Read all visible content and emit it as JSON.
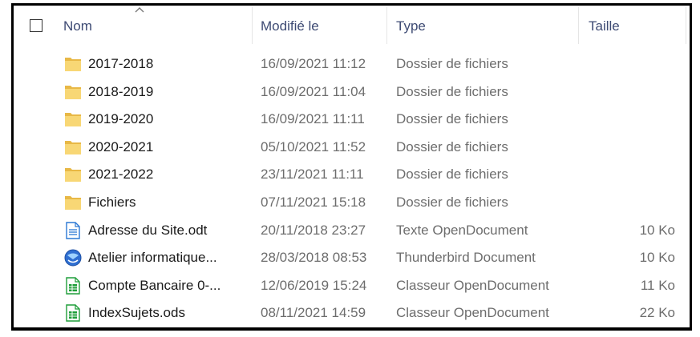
{
  "header": {
    "name": "Nom",
    "modified": "Modifié le",
    "type": "Type",
    "size": "Taille"
  },
  "colors": {
    "folder": "#f8d775",
    "folder_tab": "#e8b846",
    "header_text": "#3d4a73",
    "secondary_text": "#6d6d6d",
    "doc_blue": "#2b78d4",
    "sheet_green": "#1f9e3a"
  },
  "files": [
    {
      "name": "2017-2018",
      "modified": "16/09/2021 11:12",
      "type": "Dossier de fichiers",
      "size": "",
      "icon": "folder-icon"
    },
    {
      "name": "2018-2019",
      "modified": "16/09/2021 11:04",
      "type": "Dossier de fichiers",
      "size": "",
      "icon": "folder-icon"
    },
    {
      "name": "2019-2020",
      "modified": "16/09/2021 11:11",
      "type": "Dossier de fichiers",
      "size": "",
      "icon": "folder-icon"
    },
    {
      "name": "2020-2021",
      "modified": "05/10/2021 11:52",
      "type": "Dossier de fichiers",
      "size": "",
      "icon": "folder-icon"
    },
    {
      "name": "2021-2022",
      "modified": "23/11/2021 11:11",
      "type": "Dossier de fichiers",
      "size": "",
      "icon": "folder-icon"
    },
    {
      "name": "Fichiers",
      "modified": "07/11/2021 15:18",
      "type": "Dossier de fichiers",
      "size": "",
      "icon": "folder-icon"
    },
    {
      "name": "Adresse du Site.odt",
      "modified": "20/11/2018 23:27",
      "type": "Texte OpenDocument",
      "size": "10 Ko",
      "icon": "text-document-icon"
    },
    {
      "name": "Atelier informatique...",
      "modified": "28/03/2018 08:53",
      "type": "Thunderbird Document",
      "size": "10 Ko",
      "icon": "thunderbird-icon"
    },
    {
      "name": "Compte Bancaire 0-...",
      "modified": "12/06/2019 15:24",
      "type": "Classeur OpenDocument",
      "size": "11 Ko",
      "icon": "spreadsheet-icon"
    },
    {
      "name": "IndexSujets.ods",
      "modified": "08/11/2021 14:59",
      "type": "Classeur OpenDocument",
      "size": "22 Ko",
      "icon": "spreadsheet-icon"
    }
  ]
}
